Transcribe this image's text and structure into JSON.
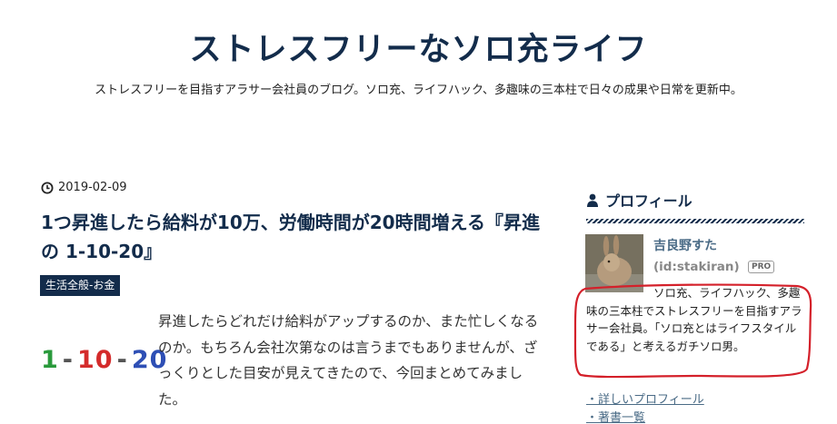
{
  "blog": {
    "title": "ストレスフリーなソロ充ライフ",
    "description": "ストレスフリーを目指すアラサー会社員のブログ。ソロ充、ライフハック、多趣味の三本柱で日々の成果や日常を更新中。"
  },
  "post": {
    "date": "2019-02-09",
    "title": "1つ昇進したら給料が10万、労働時間が20時間増える『昇進の 1-10-20』",
    "category": "生活全般-お金",
    "thumbnail": {
      "n1": "1",
      "dash1": "-",
      "n10": "10",
      "dash2": "-",
      "n20": "20"
    },
    "excerpt": "昇進したらどれだけ給料がアップするのか、また忙しくなるのか。もちろん会社次第なのは言うまでもありませんが、ざっくりとした目安が見えてきたので、今回まとめてみました。"
  },
  "sidebar": {
    "heading": "プロフィール",
    "profile": {
      "name": "吉良野すた",
      "id": "(id:stakiran)",
      "badge": "PRO",
      "bio": "ソロ充、ライフハック、多趣味の三本柱でストレスフリーを目指すアラサー会社員。「ソロ充とはライフスタイルである」と考えるガチソロ男。"
    },
    "links": [
      {
        "label": "・詳しいプロフィール"
      },
      {
        "label": "・著書一覧"
      }
    ]
  },
  "colors": {
    "brand": "#132c4b",
    "link": "#4a6b86",
    "annotation": "#d4202a",
    "thumb_green": "#2a9a3c",
    "thumb_red": "#d42b2b",
    "thumb_blue": "#2e4fb5"
  },
  "icons": {
    "date": "clock-icon",
    "profile": "user-icon"
  }
}
